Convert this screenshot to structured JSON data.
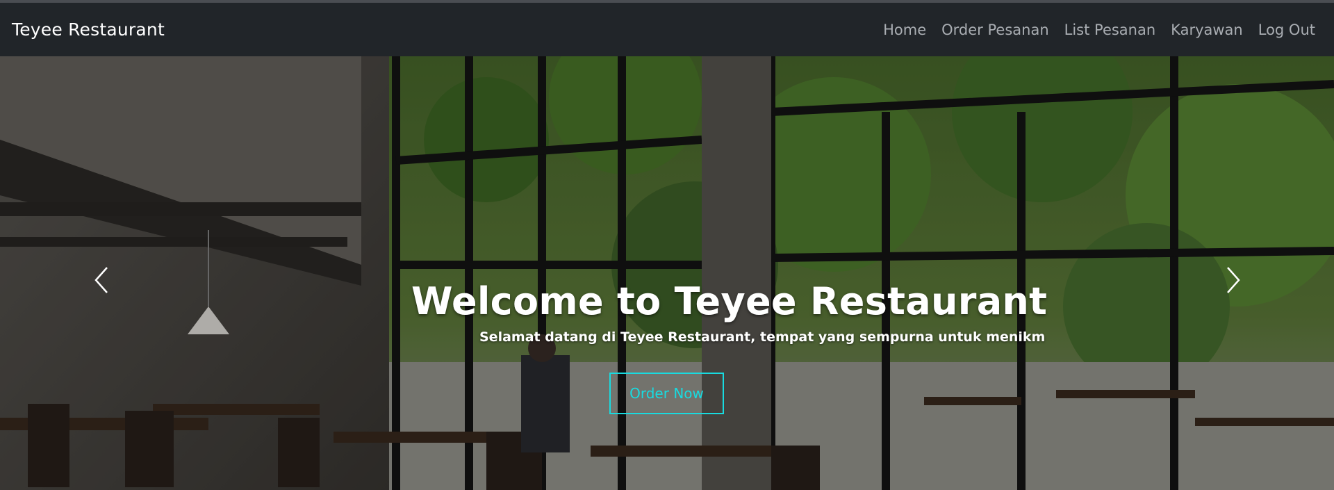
{
  "navbar": {
    "brand": "Teyee Restaurant",
    "links": [
      "Home",
      "Order Pesanan",
      "List Pesanan",
      "Karyawan",
      "Log Out"
    ]
  },
  "hero": {
    "title": "Welcome to Teyee Restaurant",
    "subtitle": "Selamat datang di Teyee Restaurant, tempat yang sempurna untuk menikm",
    "button_label": "Order Now",
    "prev_icon": "chevron-left-icon",
    "next_icon": "chevron-right-icon"
  },
  "colors": {
    "navbar_bg": "#212529",
    "accent": "#18dbe0",
    "nav_link": "#a9adb2"
  }
}
